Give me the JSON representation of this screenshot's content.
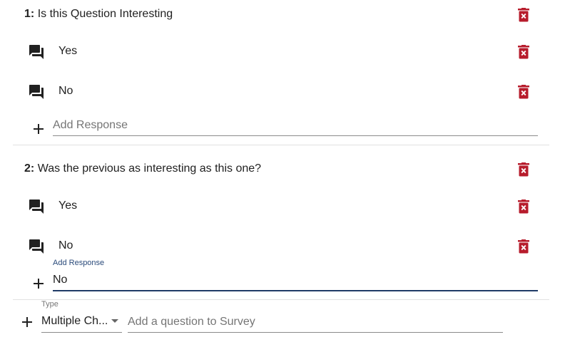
{
  "questions": [
    {
      "number": "1:",
      "text": "Is this Question Interesting",
      "responses": [
        {
          "label": "Yes"
        },
        {
          "label": "No"
        }
      ],
      "add_response": {
        "placeholder": "Add Response",
        "value": ""
      }
    },
    {
      "number": "2:",
      "text": "Was the previous as interesting as this one?",
      "responses": [
        {
          "label": "Yes"
        },
        {
          "label": "No"
        }
      ],
      "add_response": {
        "label": "Add Response",
        "value": "No"
      }
    }
  ],
  "new_question": {
    "type_label": "Type",
    "type_value": "Multiple Ch...",
    "placeholder": "Add a question to Survey"
  },
  "colors": {
    "delete": "#b71c2c",
    "icon": "#212121",
    "focus_underline": "#1f3b66"
  },
  "icons": {
    "delete": "trash-icon",
    "response": "forum-icon",
    "add": "plus-icon",
    "dropdown": "caret-down-icon"
  }
}
